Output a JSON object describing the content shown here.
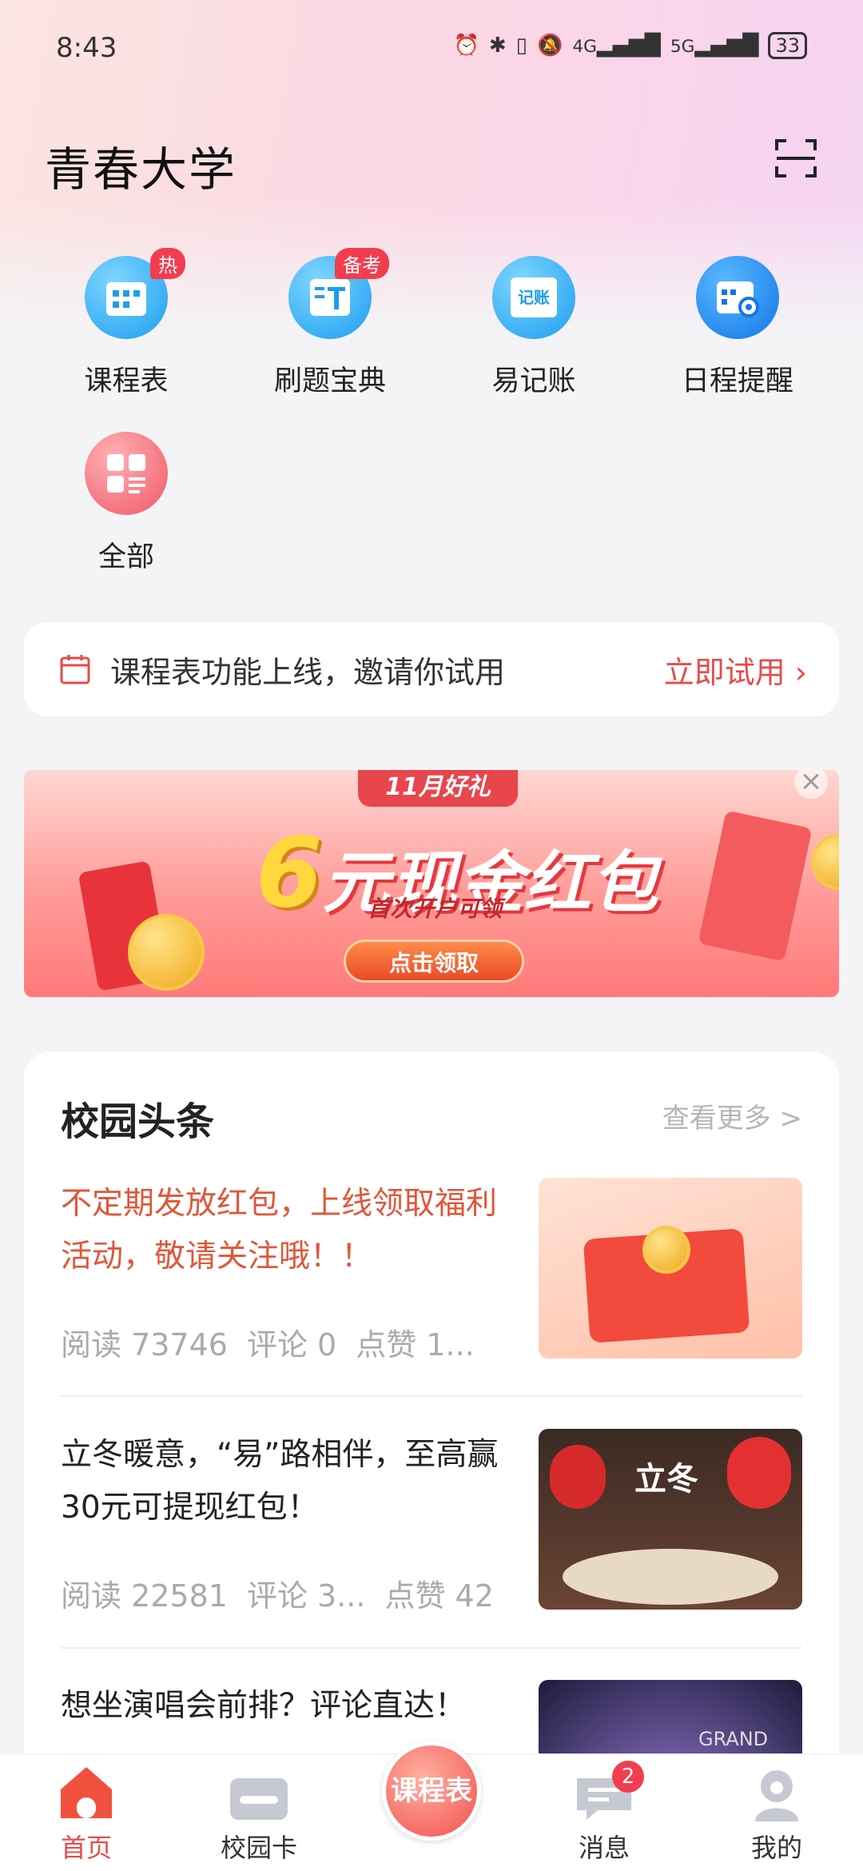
{
  "status_bar": {
    "time": "8:43",
    "signal_1": "4G",
    "signal_2": "5G",
    "battery": "33"
  },
  "header": {
    "title": "青春大学"
  },
  "quick_actions": [
    {
      "label": "课程表",
      "badge": "热",
      "icon": "calendar-grid-icon"
    },
    {
      "label": "刷题宝典",
      "badge": "备考",
      "icon": "text-book-icon"
    },
    {
      "label": "易记账",
      "badge": "",
      "icon": "ledger-icon",
      "glyph": "记账"
    },
    {
      "label": "日程提醒",
      "badge": "",
      "icon": "schedule-gear-icon"
    },
    {
      "label": "全部",
      "badge": "",
      "icon": "all-apps-icon"
    }
  ],
  "notice": {
    "text": "课程表功能上线，邀请你试用",
    "cta": "立即试用 ›"
  },
  "banner": {
    "tag": "11月好礼",
    "amount": "6",
    "headline": "元现金红包",
    "subtitle": "首次开户可领",
    "button": "点击领取",
    "close": "×"
  },
  "campus_news": {
    "title": "校园头条",
    "more": "查看更多 >",
    "items": [
      {
        "title": "不定期发放红包，上线领取福利活动，敬请关注哦！！",
        "reads": "阅读 73746",
        "comments": "评论 0",
        "likes": "点赞 1..."
      },
      {
        "title": "立冬暖意，“易”路相伴，至高赢30元可提现红包！",
        "reads": "阅读 22581",
        "comments": "评论 3...",
        "likes": "点赞 42",
        "thumb_text": "立冬"
      },
      {
        "title": "想坐演唱会前排？评论直达！",
        "thumb_text": "GRAND"
      }
    ]
  },
  "tab_bar": {
    "home": "首页",
    "campus_card": "校园卡",
    "center": "课程表",
    "messages": "消息",
    "messages_badge": "2",
    "mine": "我的"
  },
  "colors": {
    "accent": "#e84b4b",
    "news_highlight": "#e0573a",
    "badge": "#f23d4f"
  }
}
